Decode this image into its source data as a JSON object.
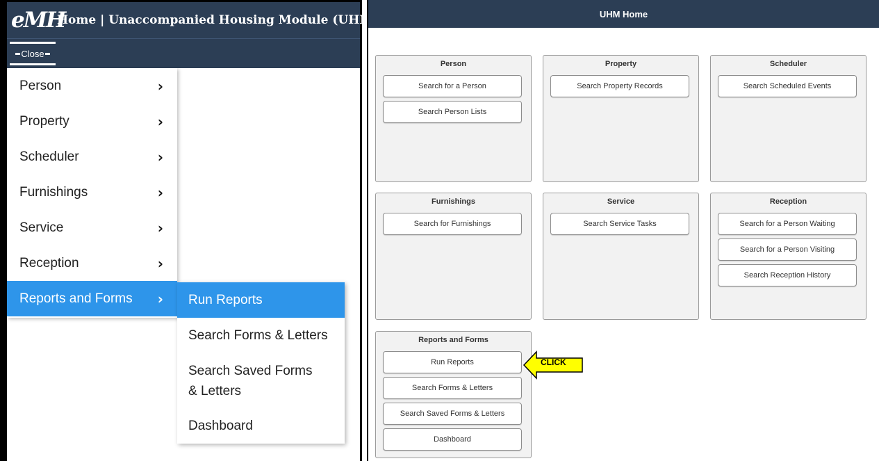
{
  "left": {
    "logo": "eMH",
    "title": "Home | Unaccompanied Housing Module (UHM)",
    "close_label": "Close",
    "menu": [
      {
        "label": "Person"
      },
      {
        "label": "Property"
      },
      {
        "label": "Scheduler"
      },
      {
        "label": "Furnishings"
      },
      {
        "label": "Service"
      },
      {
        "label": "Reception"
      },
      {
        "label": "Reports and Forms"
      }
    ],
    "submenu": [
      {
        "label": "Run Reports"
      },
      {
        "label": "Search Forms & Letters"
      },
      {
        "label": "Search Saved Forms & Letters"
      },
      {
        "label": "Dashboard"
      }
    ]
  },
  "right": {
    "title": "UHM Home",
    "cards": {
      "person": {
        "title": "Person",
        "buttons": [
          "Search for a Person",
          "Search Person Lists"
        ]
      },
      "property": {
        "title": "Property",
        "buttons": [
          "Search Property Records"
        ]
      },
      "scheduler": {
        "title": "Scheduler",
        "buttons": [
          "Search Scheduled Events"
        ]
      },
      "furnishings": {
        "title": "Furnishings",
        "buttons": [
          "Search for Furnishings"
        ]
      },
      "service": {
        "title": "Service",
        "buttons": [
          "Search Service Tasks"
        ]
      },
      "reception": {
        "title": "Reception",
        "buttons": [
          "Search for a Person Waiting",
          "Search for a Person Visiting",
          "Search Reception History"
        ]
      },
      "reports": {
        "title": "Reports and Forms",
        "buttons": [
          "Run Reports",
          "Search Forms & Letters",
          "Search Saved Forms & Letters",
          "Dashboard"
        ]
      }
    },
    "callout": "CLICK"
  },
  "colors": {
    "header_navy": "#2c3e55",
    "active_blue": "#2e95ea",
    "callout_yellow": "#ffff00"
  }
}
